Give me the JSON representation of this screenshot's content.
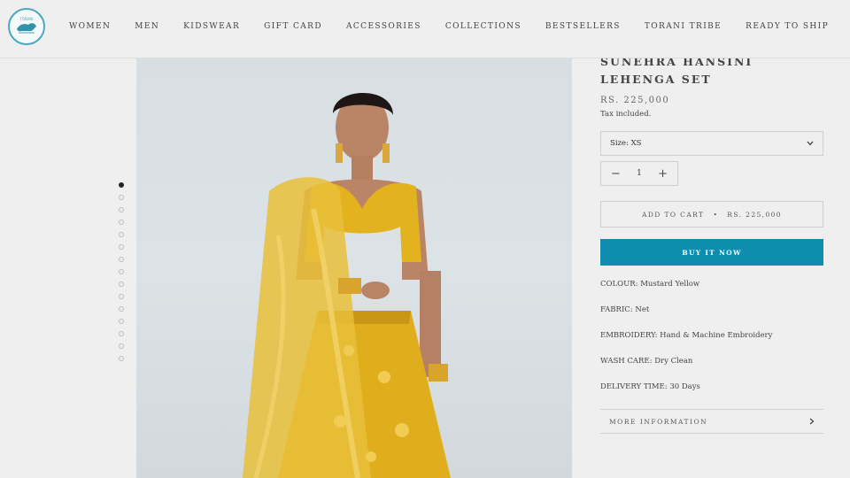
{
  "header": {
    "logo_text": "TORANI",
    "nav": [
      "WOMEN",
      "MEN",
      "KIDSWEAR",
      "GIFT CARD",
      "ACCESSORIES",
      "COLLECTIONS",
      "BESTSELLERS",
      "TORANI TRIBE",
      "READY TO SHIP"
    ]
  },
  "gallery": {
    "dot_count": 15,
    "active_index": 0
  },
  "product": {
    "title": "SUNEHRA HANSINI LEHENGA SET",
    "price": "RS. 225,000",
    "tax_note": "Tax included.",
    "size_value": "Size: XS",
    "quantity": "1",
    "add_to_cart": "ADD TO CART",
    "add_to_cart_price": "RS. 225,000",
    "buy_now": "BUY IT NOW",
    "specs": [
      {
        "label": "COLOUR:",
        "value": "Mustard Yellow"
      },
      {
        "label": "FABRIC:",
        "value": "Net"
      },
      {
        "label": "EMBROIDERY:",
        "value": "Hand & Machine Embroidery"
      },
      {
        "label": "WASH CARE:",
        "value": "Dry Clean"
      },
      {
        "label": "DELIVERY TIME:",
        "value": "30 Days"
      }
    ],
    "more_info": "MORE INFORMATION"
  },
  "colors": {
    "accent": "#0f8dae",
    "background": "#efefef",
    "garment": "#e3b21f"
  }
}
